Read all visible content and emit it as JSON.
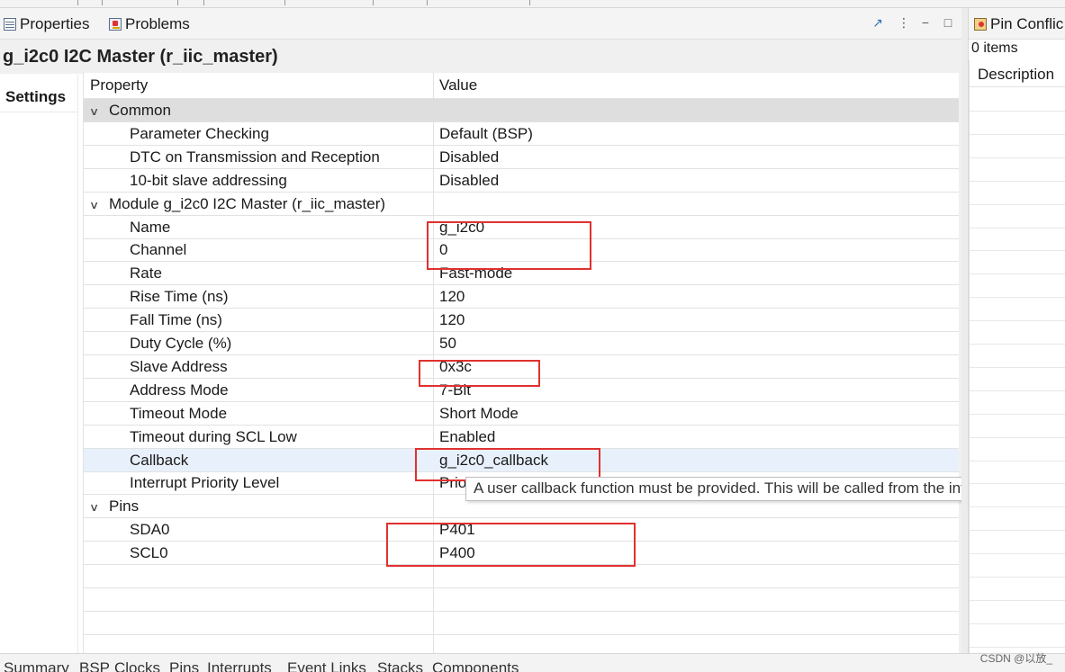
{
  "tabs": {
    "properties": "Properties",
    "problems": "Problems",
    "pin_conflicts": "Pin Conflic"
  },
  "page_title": "g_i2c0 I2C Master (r_iic_master)",
  "settings_tab": "Settings",
  "table": {
    "header_property": "Property",
    "header_value": "Value",
    "rows": [
      {
        "kind": "category",
        "label": "Common",
        "value": ""
      },
      {
        "kind": "property",
        "label": "Parameter Checking",
        "value": "Default (BSP)"
      },
      {
        "kind": "property",
        "label": "DTC on Transmission and Reception",
        "value": "Disabled"
      },
      {
        "kind": "property",
        "label": "10-bit slave addressing",
        "value": "Disabled"
      },
      {
        "kind": "category",
        "label": "Module g_i2c0 I2C Master (r_iic_master)",
        "value": ""
      },
      {
        "kind": "property",
        "label": "Name",
        "value": "g_i2c0"
      },
      {
        "kind": "property",
        "label": "Channel",
        "value": "0"
      },
      {
        "kind": "property",
        "label": "Rate",
        "value": "Fast-mode"
      },
      {
        "kind": "property",
        "label": "Rise Time (ns)",
        "value": "120"
      },
      {
        "kind": "property",
        "label": "Fall Time (ns)",
        "value": "120"
      },
      {
        "kind": "property",
        "label": "Duty Cycle (%)",
        "value": "50"
      },
      {
        "kind": "property",
        "label": "Slave Address",
        "value": "0x3c"
      },
      {
        "kind": "property",
        "label": "Address Mode",
        "value": "7-Bit"
      },
      {
        "kind": "property",
        "label": "Timeout Mode",
        "value": "Short Mode"
      },
      {
        "kind": "property",
        "label": "Timeout during SCL Low",
        "value": "Enabled"
      },
      {
        "kind": "property",
        "label": "Callback",
        "value": "g_i2c0_callback",
        "selected": true
      },
      {
        "kind": "property",
        "label": "Interrupt Priority Level",
        "value": "Prio"
      },
      {
        "kind": "category",
        "label": "Pins",
        "value": ""
      },
      {
        "kind": "property",
        "label": "SDA0",
        "value": "P401"
      },
      {
        "kind": "property",
        "label": "SCL0",
        "value": "P400"
      }
    ]
  },
  "tooltip": "A user callback function must be provided. This will be called from the interrupt s",
  "pin_conflicts": {
    "count": "0 items",
    "column": "Description"
  },
  "bottom_tabs": [
    "Summary",
    "BSP",
    "Clocks",
    "Pins",
    "Interrupts",
    "Event Links",
    "Stacks",
    "Components"
  ],
  "watermark": "CSDN @以放_",
  "icons": {
    "open_console": "open-in-new-icon",
    "view_menu": "view-menu-icon",
    "minimize": "minimize-icon",
    "maximize": "maximize-icon",
    "expand": "chevron-down-icon"
  },
  "colors": {
    "highlight_box": "#e0312f",
    "selected_row": "#e8f1fb",
    "category_row": "#dedede"
  }
}
